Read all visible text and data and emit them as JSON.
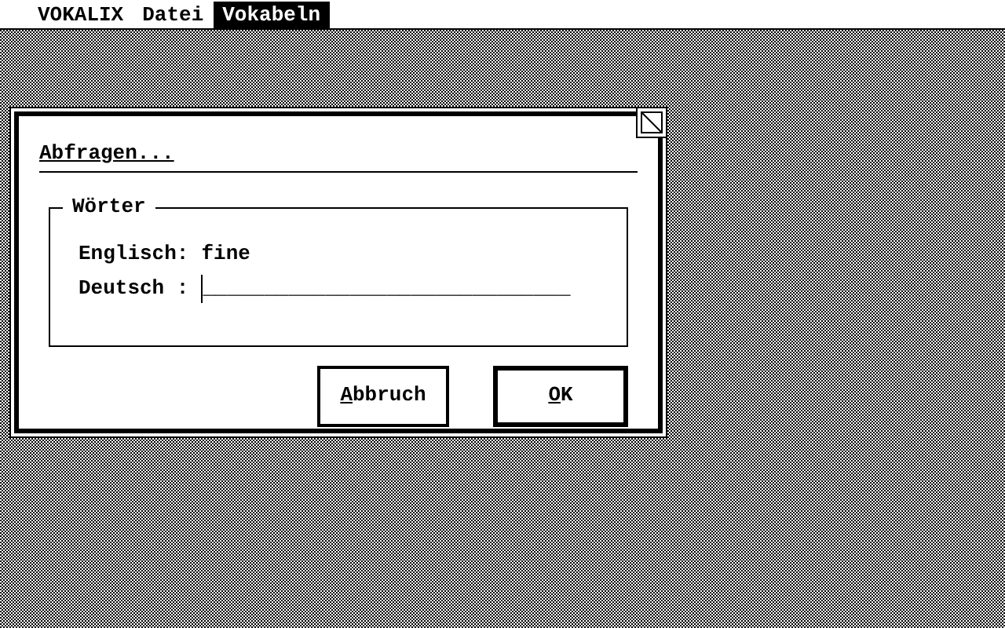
{
  "menu_bar": [
    {
      "label": "VOKALIX",
      "selected": false
    },
    {
      "label": "Datei",
      "selected": false
    },
    {
      "label": "Vokabeln",
      "selected": true
    }
  ],
  "dialog": {
    "title": "Abfragen...",
    "group": {
      "title": "Wörter",
      "rows": [
        {
          "kind": "text",
          "label": "Englisch:",
          "value": "fine"
        },
        {
          "kind": "field",
          "label": "Deutsch :",
          "placeholder": "______________________________",
          "value": ""
        }
      ]
    },
    "buttons": [
      {
        "label": "Abbruch",
        "default": false
      },
      {
        "label": "OK",
        "default": true
      }
    ]
  }
}
